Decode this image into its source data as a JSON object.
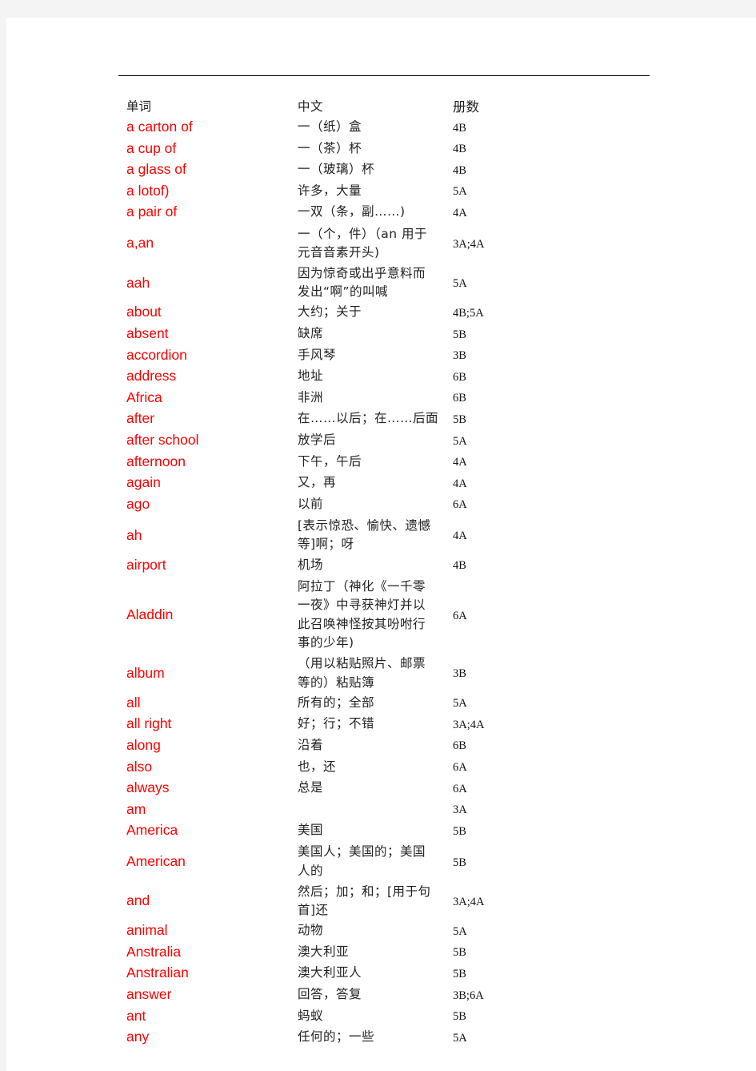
{
  "document": {
    "columns": {
      "word": "单词",
      "chinese": "中文",
      "book": "册数"
    },
    "rows": [
      {
        "word": "a carton of",
        "chinese": [
          "一（纸）盒"
        ],
        "book": "4B"
      },
      {
        "word": "a cup of",
        "chinese": [
          "一（茶）杯"
        ],
        "book": "4B"
      },
      {
        "word": "a glass of",
        "chinese": [
          "一（玻璃）杯"
        ],
        "book": "4B"
      },
      {
        "word": "a lotof)",
        "chinese": [
          "许多，大量"
        ],
        "book": "5A"
      },
      {
        "word": "a pair of",
        "chinese": [
          "一双（条，副……)"
        ],
        "book": "4A"
      },
      {
        "word": "a,an",
        "chinese": [
          "一（个，件）（an 用于",
          "元音音素开头)"
        ],
        "book": "3A;4A"
      },
      {
        "word": "aah",
        "chinese": [
          "因为惊奇或出乎意料而",
          "发出“啊”的叫喊"
        ],
        "book": "5A"
      },
      {
        "word": "about",
        "chinese": [
          "大约；关于"
        ],
        "book": "4B;5A"
      },
      {
        "word": "absent",
        "chinese": [
          "缺席"
        ],
        "book": "5B"
      },
      {
        "word": "accordion",
        "chinese": [
          "手风琴"
        ],
        "book": "3B"
      },
      {
        "word": "address",
        "chinese": [
          "地址"
        ],
        "book": "6B"
      },
      {
        "word": "Africa",
        "chinese": [
          "非洲"
        ],
        "book": "6B"
      },
      {
        "word": "after",
        "chinese": [
          "在……以后；在……后面"
        ],
        "book": "5B"
      },
      {
        "word": "after school",
        "chinese": [
          "放学后"
        ],
        "book": "5A"
      },
      {
        "word": "afternoon",
        "chinese": [
          "下午，午后"
        ],
        "book": "4A"
      },
      {
        "word": "again",
        "chinese": [
          "又，再"
        ],
        "book": "4A"
      },
      {
        "word": "ago",
        "chinese": [
          "以前"
        ],
        "book": "6A"
      },
      {
        "word": "ah",
        "chinese": [
          "[表示惊恐、愉快、遗憾",
          "等]啊；呀"
        ],
        "book": "4A"
      },
      {
        "word": "airport",
        "chinese": [
          "机场"
        ],
        "book": "4B"
      },
      {
        "word": "Aladdin",
        "chinese": [
          "阿拉丁（神化《一千零",
          "一夜》中寻获神灯并以",
          "此召唤神怪按其吩咐行",
          "事的少年)"
        ],
        "book": "6A"
      },
      {
        "word": "album",
        "chinese": [
          "（用以粘贴照片、邮票",
          "等的）粘贴簿"
        ],
        "book": "3B"
      },
      {
        "word": "all",
        "chinese": [
          "所有的；全部"
        ],
        "book": "5A"
      },
      {
        "word": "all right",
        "chinese": [
          "好；行；不错"
        ],
        "book": "3A;4A"
      },
      {
        "word": "along",
        "chinese": [
          "沿着"
        ],
        "book": "6B"
      },
      {
        "word": "also",
        "chinese": [
          "也，还"
        ],
        "book": "6A"
      },
      {
        "word": "always",
        "chinese": [
          "总是"
        ],
        "book": "6A"
      },
      {
        "word": "am",
        "chinese": [
          ""
        ],
        "book": "3A"
      },
      {
        "word": "America",
        "chinese": [
          "美国"
        ],
        "book": "5B"
      },
      {
        "word": "American",
        "chinese": [
          "美国人；美国的；美国",
          "人的"
        ],
        "book": "5B"
      },
      {
        "word": "and",
        "chinese": [
          "然后；加；和；[用于句",
          "首]还"
        ],
        "book": "3A;4A"
      },
      {
        "word": "animal",
        "chinese": [
          "动物"
        ],
        "book": "5A"
      },
      {
        "word": "Anstralia",
        "chinese": [
          "澳大利亚"
        ],
        "book": "5B"
      },
      {
        "word": "Anstralian",
        "chinese": [
          "澳大利亚人"
        ],
        "book": "5B"
      },
      {
        "word": "answer",
        "chinese": [
          "回答，答复"
        ],
        "book": "3B;6A"
      },
      {
        "word": "ant",
        "chinese": [
          "蚂蚁"
        ],
        "book": "5B"
      },
      {
        "word": "any",
        "chinese": [
          "任何的；一些"
        ],
        "book": "5A"
      }
    ]
  },
  "colors": {
    "word_text": "#ff0000",
    "body_text": "#222222",
    "page_background": "#ffffff",
    "viewer_background": "#f4f4f4"
  }
}
